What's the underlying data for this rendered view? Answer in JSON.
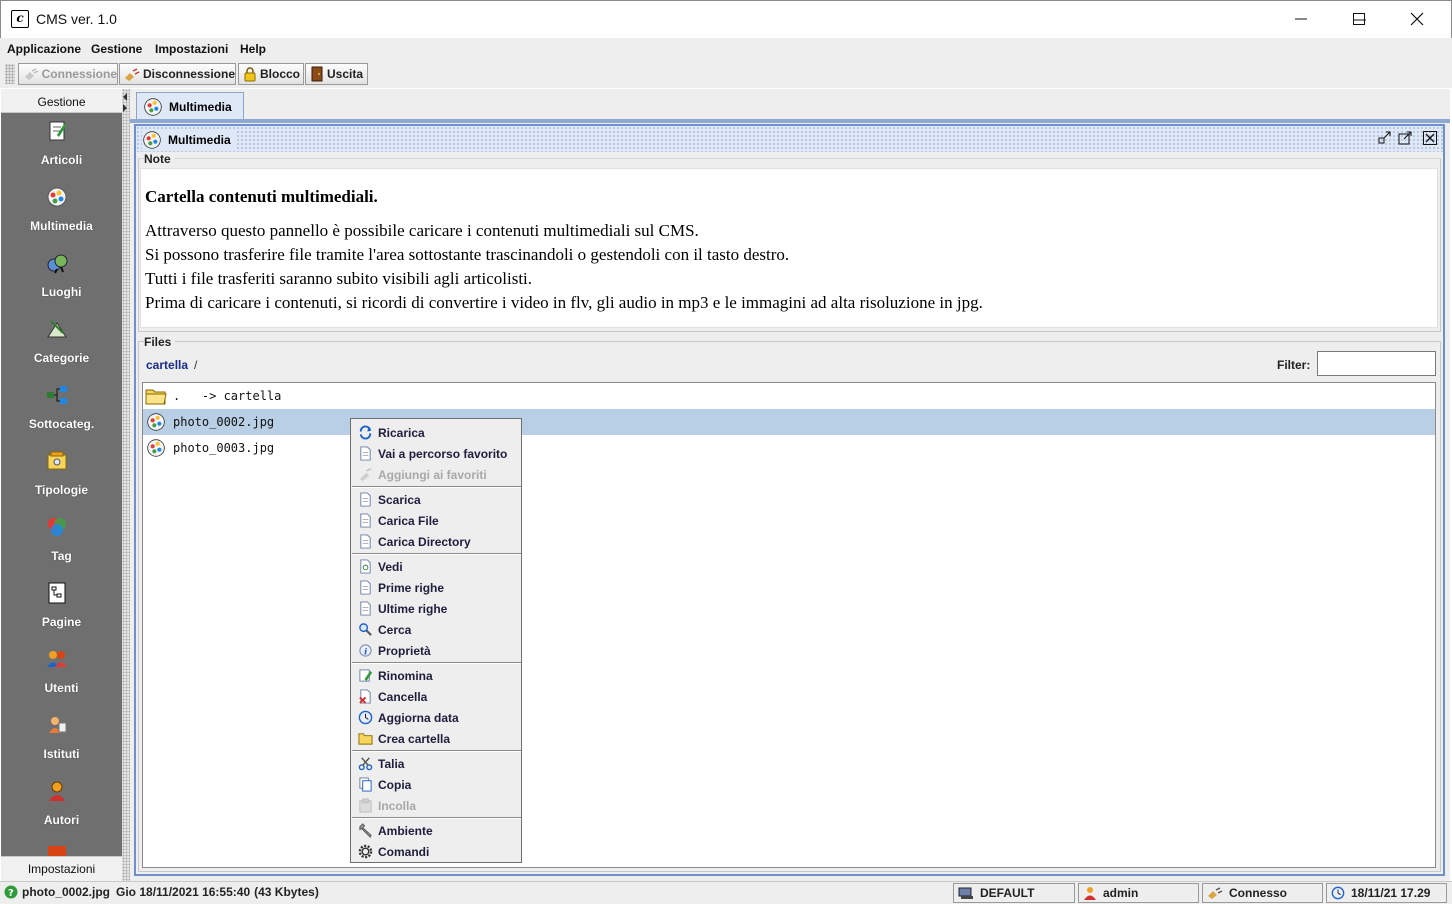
{
  "window": {
    "title": "CMS ver. 1.0",
    "app_icon_letter": "c"
  },
  "menubar": [
    "Applicazione",
    "Gestione",
    "Impostazioni",
    "Help"
  ],
  "toolbar": {
    "connect": "Connessione",
    "disconnect": "Disconnessione",
    "lock": "Blocco",
    "exit": "Uscita"
  },
  "sidebar": {
    "header": "Gestione",
    "items": [
      {
        "label": "Articoli",
        "icon": "article-icon"
      },
      {
        "label": "Multimedia",
        "icon": "multimedia-icon"
      },
      {
        "label": "Luoghi",
        "icon": "globe-icon"
      },
      {
        "label": "Categorie",
        "icon": "categories-icon"
      },
      {
        "label": "Sottocateg.",
        "icon": "hierarchy-icon"
      },
      {
        "label": "Tipologie",
        "icon": "types-icon"
      },
      {
        "label": "Tag",
        "icon": "tag-icon"
      },
      {
        "label": "Pagine",
        "icon": "page-icon"
      },
      {
        "label": "Utenti",
        "icon": "users-icon"
      },
      {
        "label": "Istituti",
        "icon": "institute-icon"
      },
      {
        "label": "Autori",
        "icon": "author-icon"
      }
    ],
    "footer": "Impostazioni"
  },
  "tab": {
    "label": "Multimedia"
  },
  "frame": {
    "title": "Multimedia"
  },
  "note": {
    "legend": "Note",
    "title": "Cartella contenuti multimediali.",
    "lines": [
      "Attraverso questo pannello è possibile caricare i contenuti multimediali sul CMS.",
      "Si possono trasferire file tramite l'area sottostante trascinandoli o gestendoli con il tasto destro.",
      "Tutti i file trasferiti saranno subito visibili agli articolisti.",
      "Prima di caricare i contenuti, si ricordi di convertire i video in flv, gli audio in mp3 e le immagini ad alta risoluzione in jpg."
    ]
  },
  "files": {
    "legend": "Files",
    "breadcrumb": "cartella",
    "breadcrumb_sep": "/",
    "filter_label": "Filter:",
    "filter_value": "",
    "rows": [
      {
        "name": ".   -> cartella",
        "icon": "folder-icon",
        "selected": false
      },
      {
        "name": "photo_0002.jpg",
        "icon": "image-file-icon",
        "selected": true
      },
      {
        "name": "photo_0003.jpg",
        "icon": "image-file-icon",
        "selected": false
      }
    ]
  },
  "context_menu": {
    "groups": [
      [
        {
          "label": "Ricarica",
          "icon": "refresh-icon",
          "enabled": true
        },
        {
          "label": "Vai a percorso favorito",
          "icon": "document-icon",
          "enabled": true
        },
        {
          "label": "Aggiungi ai favoriti",
          "icon": "bookmark-icon",
          "enabled": false
        }
      ],
      [
        {
          "label": "Scarica",
          "icon": "document-icon",
          "enabled": true
        },
        {
          "label": "Carica File",
          "icon": "document-icon",
          "enabled": true
        },
        {
          "label": "Carica Directory",
          "icon": "document-icon",
          "enabled": true
        }
      ],
      [
        {
          "label": "Vedi",
          "icon": "view-icon",
          "enabled": true
        },
        {
          "label": "Prime righe",
          "icon": "document-icon",
          "enabled": true
        },
        {
          "label": "Ultime righe",
          "icon": "document-icon",
          "enabled": true
        },
        {
          "label": "Cerca",
          "icon": "search-icon",
          "enabled": true
        },
        {
          "label": "Proprietà",
          "icon": "info-icon",
          "enabled": true
        }
      ],
      [
        {
          "label": "Rinomina",
          "icon": "rename-icon",
          "enabled": true
        },
        {
          "label": "Cancella",
          "icon": "delete-icon",
          "enabled": true
        },
        {
          "label": "Aggiorna data",
          "icon": "clock-icon",
          "enabled": true
        },
        {
          "label": "Crea cartella",
          "icon": "folder-icon",
          "enabled": true
        }
      ],
      [
        {
          "label": "Talia",
          "icon": "cut-icon",
          "enabled": true
        },
        {
          "label": "Copia",
          "icon": "copy-icon",
          "enabled": true
        },
        {
          "label": "Incolla",
          "icon": "paste-icon",
          "enabled": false
        }
      ],
      [
        {
          "label": "Ambiente",
          "icon": "wrench-icon",
          "enabled": true
        },
        {
          "label": "Comandi",
          "icon": "gear-icon",
          "enabled": true
        }
      ]
    ]
  },
  "statusbar": {
    "file": "photo_0002.jpg",
    "date": "Gio 18/11/2021 16:55:40",
    "size": "(43 Kbytes)",
    "profile": "DEFAULT",
    "user": "admin",
    "connection": "Connesso",
    "clock": "18/11/21 17.29"
  },
  "colors": {
    "sidebar_bg": "#6f6f6f",
    "selection": "#b8cfe5",
    "frame_border": "#6d8fca",
    "link": "#1a2c8a"
  }
}
